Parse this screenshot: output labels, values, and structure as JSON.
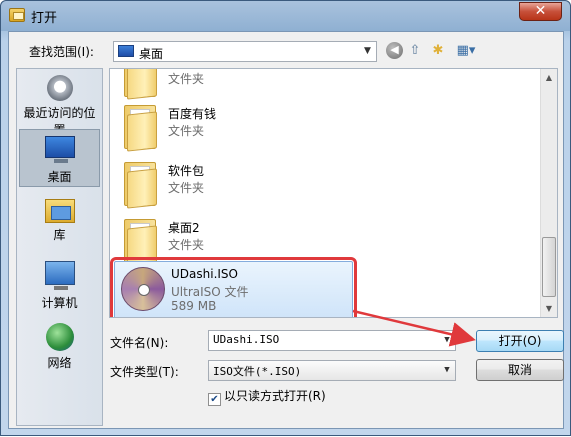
{
  "window": {
    "title": "打开",
    "close_label": "✕"
  },
  "toolbar": {
    "lookin_label": "查找范围(I):",
    "lookin_value": "桌面",
    "icons": [
      "back-icon",
      "up-folder-icon",
      "new-folder-icon",
      "view-menu-icon"
    ]
  },
  "places": [
    {
      "label": "最近访问的位置",
      "icon": "recent-places-icon"
    },
    {
      "label": "桌面",
      "icon": "desktop-icon",
      "active": true
    },
    {
      "label": "库",
      "icon": "libraries-icon"
    },
    {
      "label": "计算机",
      "icon": "computer-icon"
    },
    {
      "label": "网络",
      "icon": "network-icon"
    }
  ],
  "files": [
    {
      "name": "",
      "type": "文件夹"
    },
    {
      "name": "百度有钱",
      "type": "文件夹"
    },
    {
      "name": "软件包",
      "type": "文件夹"
    },
    {
      "name": "桌面2",
      "type": "文件夹"
    }
  ],
  "selected_file": {
    "name": "UDashi.ISO",
    "type": "UltraISO 文件",
    "size": "589 MB"
  },
  "form": {
    "filename_label": "文件名(N):",
    "filename_value": "UDashi.ISO",
    "filetype_label": "文件类型(T):",
    "filetype_value": "ISO文件(*.ISO)",
    "readonly_label": "以只读方式打开(R)",
    "readonly_checked": true
  },
  "buttons": {
    "open": "打开(O)",
    "cancel": "取消"
  },
  "colors": {
    "highlight_outline": "#e0393c",
    "annotation_arrow": "#e0393c"
  }
}
